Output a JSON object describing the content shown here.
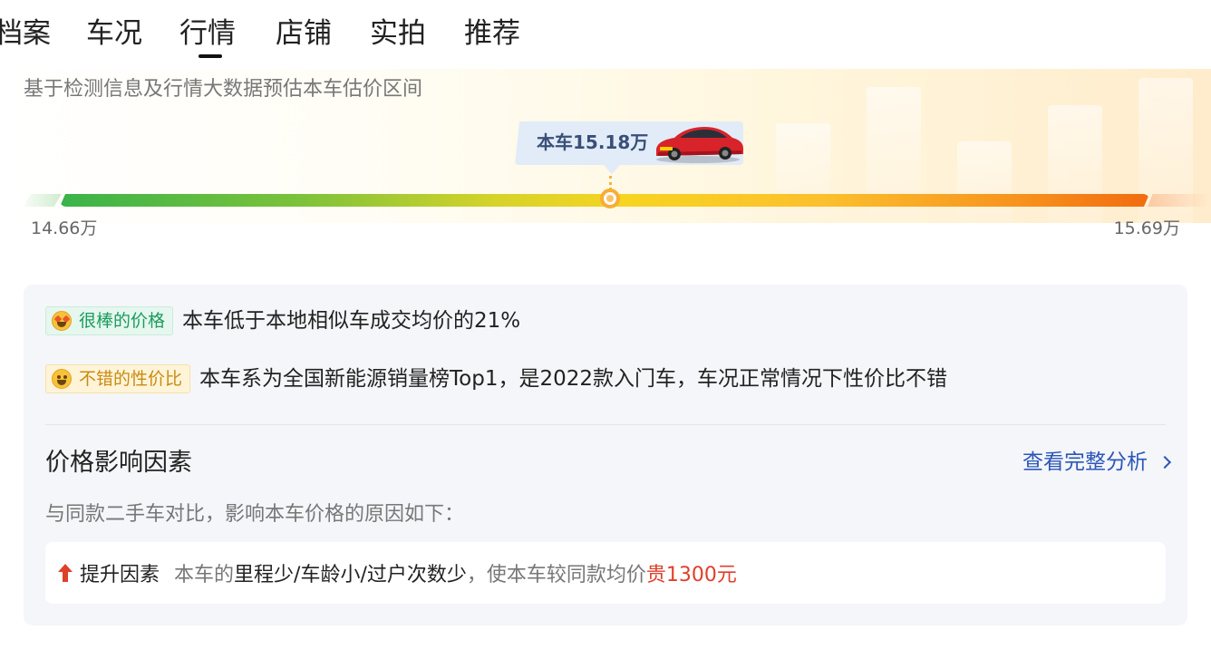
{
  "tabs": [
    {
      "label": "档案",
      "active": false
    },
    {
      "label": "车况",
      "active": false
    },
    {
      "label": "行情",
      "active": true
    },
    {
      "label": "店铺",
      "active": false
    },
    {
      "label": "实拍",
      "active": false
    },
    {
      "label": "推荐",
      "active": false
    }
  ],
  "range": {
    "subtitle": "基于检测信息及行情大数据预估本车估价区间",
    "current_price_label": "本车15.18万",
    "min_label": "14.66万",
    "max_label": "15.69万",
    "min_value": 14.66,
    "max_value": 15.69,
    "current_value": 15.18,
    "car_icon": "red-sedan-icon"
  },
  "analysis": {
    "items": [
      {
        "badge": "很棒的价格",
        "badge_icon": "star-eyes-emoji-icon",
        "text": "本车低于本地相似车成交均价的21%"
      },
      {
        "badge": "不错的性价比",
        "badge_icon": "smile-emoji-icon",
        "text": "本车系为全国新能源销量榜Top1，是2022款入门车，车况正常情况下性价比不错"
      }
    ],
    "factors_title": "价格影响因素",
    "full_analysis_link": "查看完整分析",
    "factors_desc": "与同款二手车对比，影响本车价格的原因如下：",
    "factor": {
      "label": "提升因素",
      "prefix": "本车的",
      "reasons": "里程少/车龄小/过户次数少",
      "middle": "，使本车较同款均价",
      "result": "贵1300元"
    }
  },
  "colors": {
    "link": "#2b57b8",
    "positive_badge": "#1b9b5e",
    "neutral_badge": "#c98a12",
    "price_up": "#e0402a",
    "marker": "#f9ad35"
  }
}
